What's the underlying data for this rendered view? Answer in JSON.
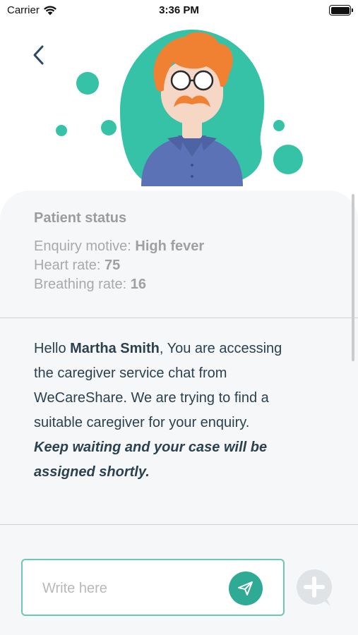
{
  "status_bar": {
    "carrier": "Carrier",
    "time": "3:36 PM",
    "wifi_icon": "wifi-icon",
    "battery_icon": "battery-icon"
  },
  "navigation": {
    "back_icon": "chevron-left-icon"
  },
  "hero": {
    "illustration": "patient-avatar-illustration"
  },
  "patient_status": {
    "title": "Patient status",
    "enquiry_label": "Enquiry motive: ",
    "enquiry_value": "High fever",
    "heart_label": "Heart rate: ",
    "heart_value": "75",
    "breathing_label": "Breathing rate: ",
    "breathing_value": "16"
  },
  "message": {
    "greeting": "Hello ",
    "name": "Martha Smith",
    "body": ", You are accessing the caregiver service chat from WeCareShare. We are trying to find a suitable caregiver for your enquiry.",
    "emphasis": "Keep waiting and your case will be assigned shortly."
  },
  "composer": {
    "placeholder": "Write here",
    "value": "",
    "send_icon": "paper-plane-icon",
    "add_icon": "plus-icon"
  },
  "colors": {
    "accent": "#2faa94",
    "accent_light": "#36c2a6",
    "text_dark": "#2c4150",
    "text_muted": "#a9a9a9",
    "panel": "#f6f7f8"
  }
}
